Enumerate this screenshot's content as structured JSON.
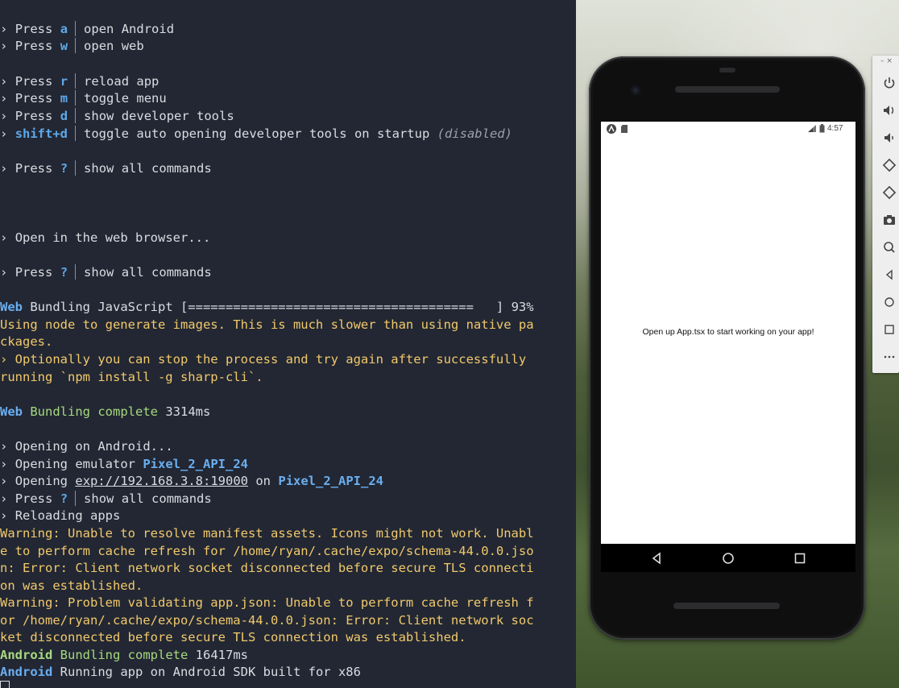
{
  "terminal": {
    "press": "Press",
    "prompt": "›",
    "commands_top": [
      {
        "key": "a",
        "label": "open Android"
      },
      {
        "key": "w",
        "label": "open web"
      }
    ],
    "commands_mid": [
      {
        "key": "r",
        "label": "reload app"
      },
      {
        "key": "m",
        "label": "toggle menu"
      },
      {
        "key": "d",
        "label": "show developer tools"
      }
    ],
    "shift_cmd": {
      "key": "shift+d",
      "label": "toggle auto opening developer tools on startup",
      "state": "(disabled)"
    },
    "help": {
      "key": "?",
      "label": "show all commands"
    },
    "open_web": "Open in the web browser...",
    "bundling_web": {
      "platform": "Web",
      "text": "Bundling JavaScript [======================================   ] 93%"
    },
    "sharp_warning": [
      "Using node to generate images. This is much slower than using native pa",
      "ckages.",
      "› Optionally you can stop the process and try again after successfully",
      "running `npm install -g sharp-cli`."
    ],
    "web_complete": {
      "platform": "Web",
      "text": "Bundling complete",
      "time": "3314ms"
    },
    "opening_android": "Opening on Android...",
    "opening_emulator": {
      "text": "Opening emulator",
      "device": "Pixel_2_API_24"
    },
    "opening_url": {
      "text": "Opening",
      "url": "exp://192.168.3.8:19000",
      "on": "on",
      "device": "Pixel_2_API_24"
    },
    "reloading": "Reloading apps",
    "warnings": [
      "Warning: Unable to resolve manifest assets. Icons might not work. Unabl",
      "e to perform cache refresh for /home/ryan/.cache/expo/schema-44.0.0.jso",
      "n: Error: Client network socket disconnected before secure TLS connecti",
      "on was established.",
      "Warning: Problem validating app.json: Unable to perform cache refresh f",
      "or /home/ryan/.cache/expo/schema-44.0.0.json: Error: Client network soc",
      "ket disconnected before secure TLS connection was established."
    ],
    "android_complete": {
      "platform": "Android",
      "text": "Bundling complete",
      "time": "16417ms"
    },
    "android_running": {
      "platform": "Android",
      "text": "Running app on Android SDK built for x86"
    }
  },
  "emulator": {
    "status_time": "4:57",
    "app_message": "Open up App.tsx to start working on your app!",
    "toolbar_top": "– ×"
  },
  "colors": {
    "terminal_bg": "#222733",
    "key_blue": "#5fa8e8",
    "success_green": "#a7d97f",
    "warning_yellow": "#f2c96b"
  }
}
